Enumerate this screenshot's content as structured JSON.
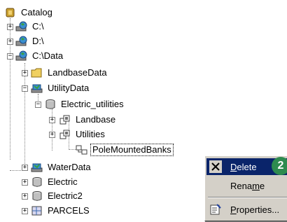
{
  "tree": {
    "items": [
      {
        "label": "Catalog",
        "icon": "catalog-icon"
      },
      {
        "label": "C:\\",
        "icon": "drive-icon"
      },
      {
        "label": "D:\\",
        "icon": "drive-icon"
      },
      {
        "label": "C:\\Data",
        "icon": "drive-icon"
      },
      {
        "label": "LandbaseData",
        "icon": "folder-icon"
      },
      {
        "label": "UtilityData",
        "icon": "dataset-icon"
      },
      {
        "label": "Electric_utilities",
        "icon": "geodatabase-icon"
      },
      {
        "label": "Landbase",
        "icon": "feature-dataset-icon"
      },
      {
        "label": "Utilities",
        "icon": "feature-dataset-icon"
      },
      {
        "label": "PoleMountedBanks",
        "icon": "relationship-class-icon"
      },
      {
        "label": "WaterData",
        "icon": "dataset-icon"
      },
      {
        "label": "Electric",
        "icon": "geodatabase-icon"
      },
      {
        "label": "Electric2",
        "icon": "geodatabase-icon"
      },
      {
        "label": "PARCELS",
        "icon": "coverage-icon"
      }
    ]
  },
  "context_menu": {
    "items": [
      {
        "pre": "",
        "ul": "D",
        "post": "elete",
        "icon": "delete-icon"
      },
      {
        "pre": "Rena",
        "ul": "m",
        "post": "e",
        "icon": ""
      },
      {
        "pre": "",
        "ul": "P",
        "post": "roperties...",
        "icon": "properties-icon"
      }
    ]
  },
  "callout": {
    "number": "2"
  },
  "colors": {
    "highlight": "#0a246a",
    "menu_bg": "#d4d0c8",
    "callout": "#2e8b4f"
  }
}
